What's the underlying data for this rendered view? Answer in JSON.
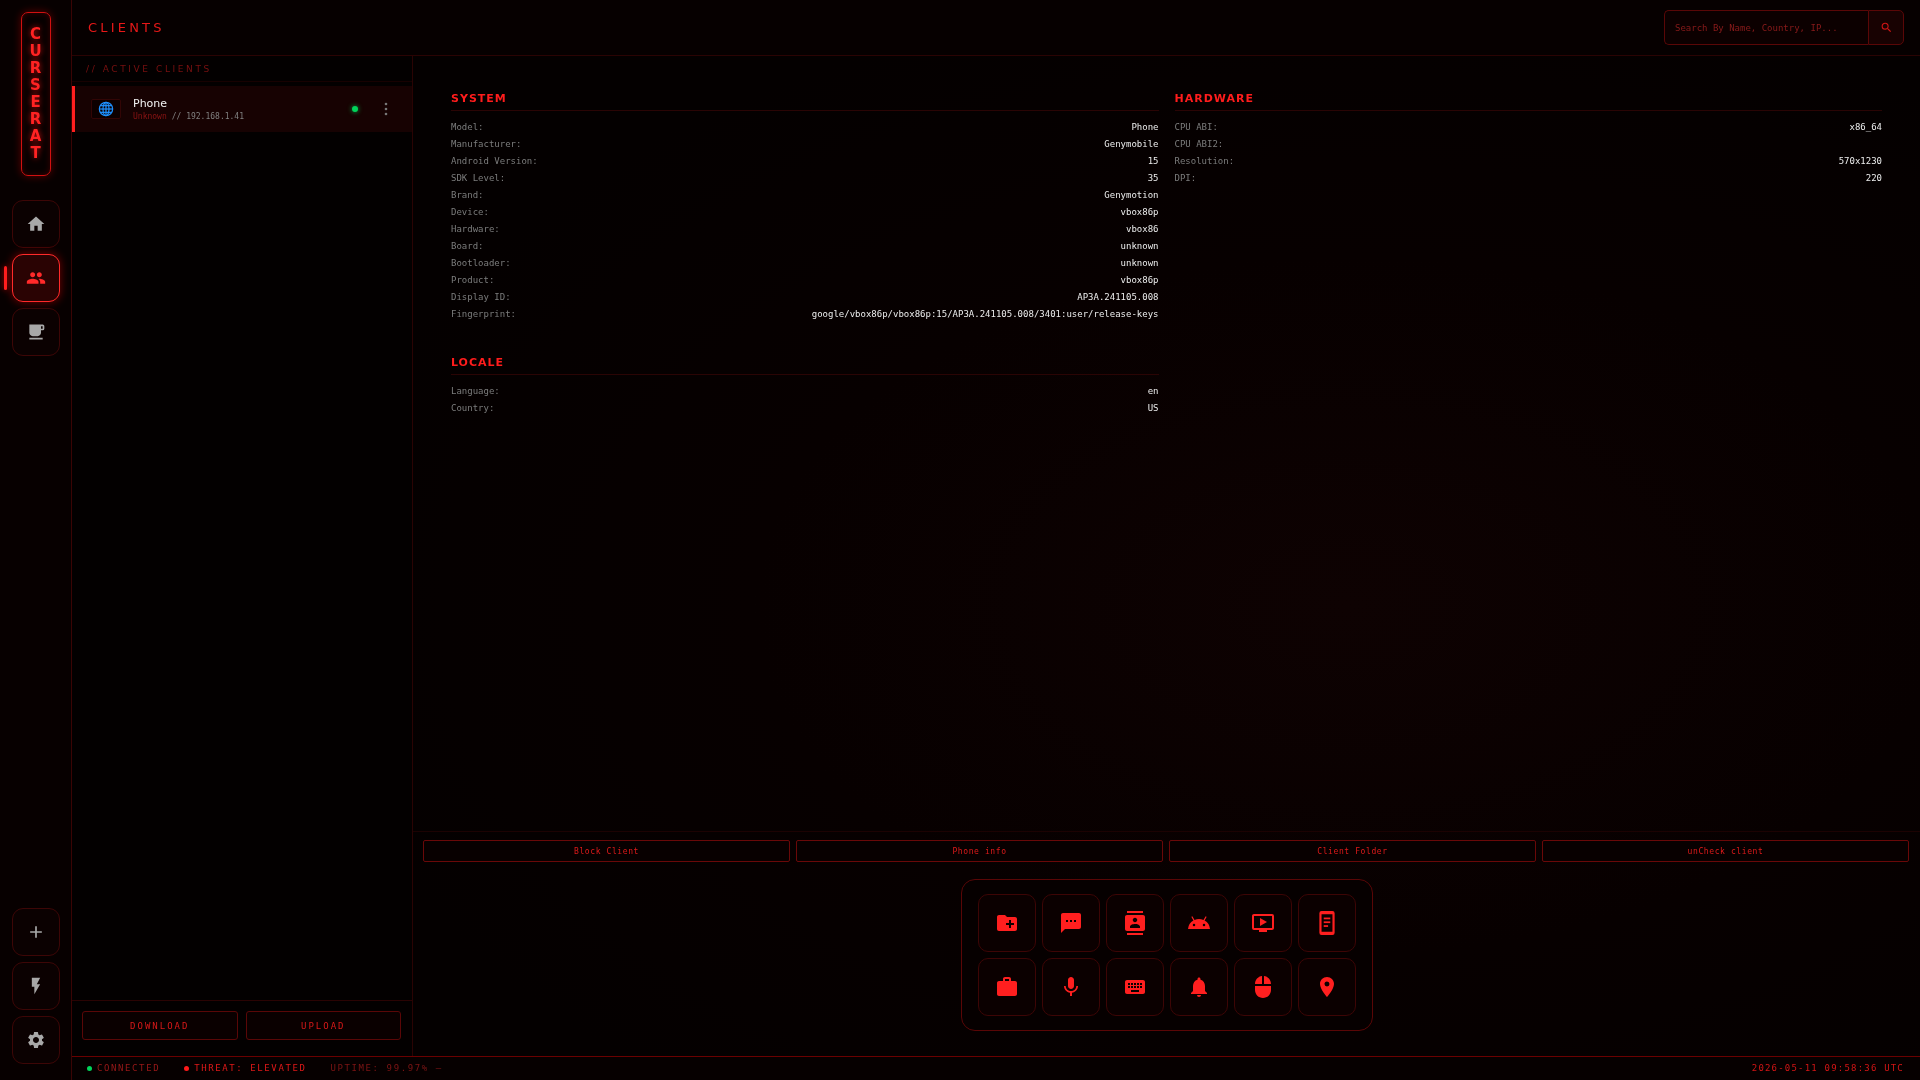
{
  "sidebar": {
    "logo": "CURSE RAT",
    "nav": [
      {
        "selected": false
      },
      {
        "selected": true
      },
      {
        "selected": false
      }
    ]
  },
  "header": {
    "title": "CLIENTS",
    "search": {
      "placeholder": "Search By Name, Country, IP..."
    }
  },
  "client_list": {
    "heading": "// ACTIVE CLIENTS",
    "clients": [
      {
        "name": "Phone",
        "country": "Unknown",
        "address": "// 192.168.1.41",
        "online": true,
        "selected": true
      }
    ],
    "buttons": [
      "DOWNLOAD",
      "UPLOAD"
    ]
  },
  "details": {
    "columns": [
      {
        "sections": [
          {
            "title": "SYSTEM",
            "rows": [
              {
                "label": "Model:",
                "value": "Phone"
              },
              {
                "label": "Manufacturer:",
                "value": "Genymobile"
              },
              {
                "label": "Android Version:",
                "value": "15"
              },
              {
                "label": "SDK Level:",
                "value": "35"
              },
              {
                "label": "Brand:",
                "value": "Genymotion"
              },
              {
                "label": "Device:",
                "value": "vbox86p"
              },
              {
                "label": "Hardware:",
                "value": "vbox86"
              },
              {
                "label": "Board:",
                "value": "unknown"
              },
              {
                "label": "Bootloader:",
                "value": "unknown"
              },
              {
                "label": "Product:",
                "value": "vbox86p"
              },
              {
                "label": "Display ID:",
                "value": "AP3A.241105.008"
              },
              {
                "label": "Fingerprint:",
                "value": "google/vbox86p/vbox86p:15/AP3A.241105.008/3401:user/release-keys"
              }
            ]
          },
          {
            "title": "LOCALE",
            "rows": [
              {
                "label": "Language:",
                "value": "en"
              },
              {
                "label": "Country:",
                "value": "US"
              }
            ]
          }
        ]
      },
      {
        "sections": [
          {
            "title": "HARDWARE",
            "rows": [
              {
                "label": "CPU ABI:",
                "value": "x86_64"
              },
              {
                "label": "CPU ABI2:"
              },
              {
                "label": "Resolution:",
                "value": "570x1230"
              },
              {
                "label": "DPI:",
                "value": "220"
              }
            ]
          }
        ]
      }
    ]
  },
  "actions": [
    "Block Client",
    "Phone info",
    "Client Folder",
    "unCheck client"
  ],
  "status_bar": {
    "items": [
      {
        "kind": "ok",
        "text": "CONNECTED",
        "color": "#00d45a"
      },
      {
        "kind": "alert",
        "text": "THREAT: ELEVATED",
        "color": "#ff1a1a"
      },
      {
        "kind": "ticker",
        "text": "UPTIME: 99.97% —"
      }
    ],
    "clock": "2026-05-11 09:58:36 UTC"
  }
}
